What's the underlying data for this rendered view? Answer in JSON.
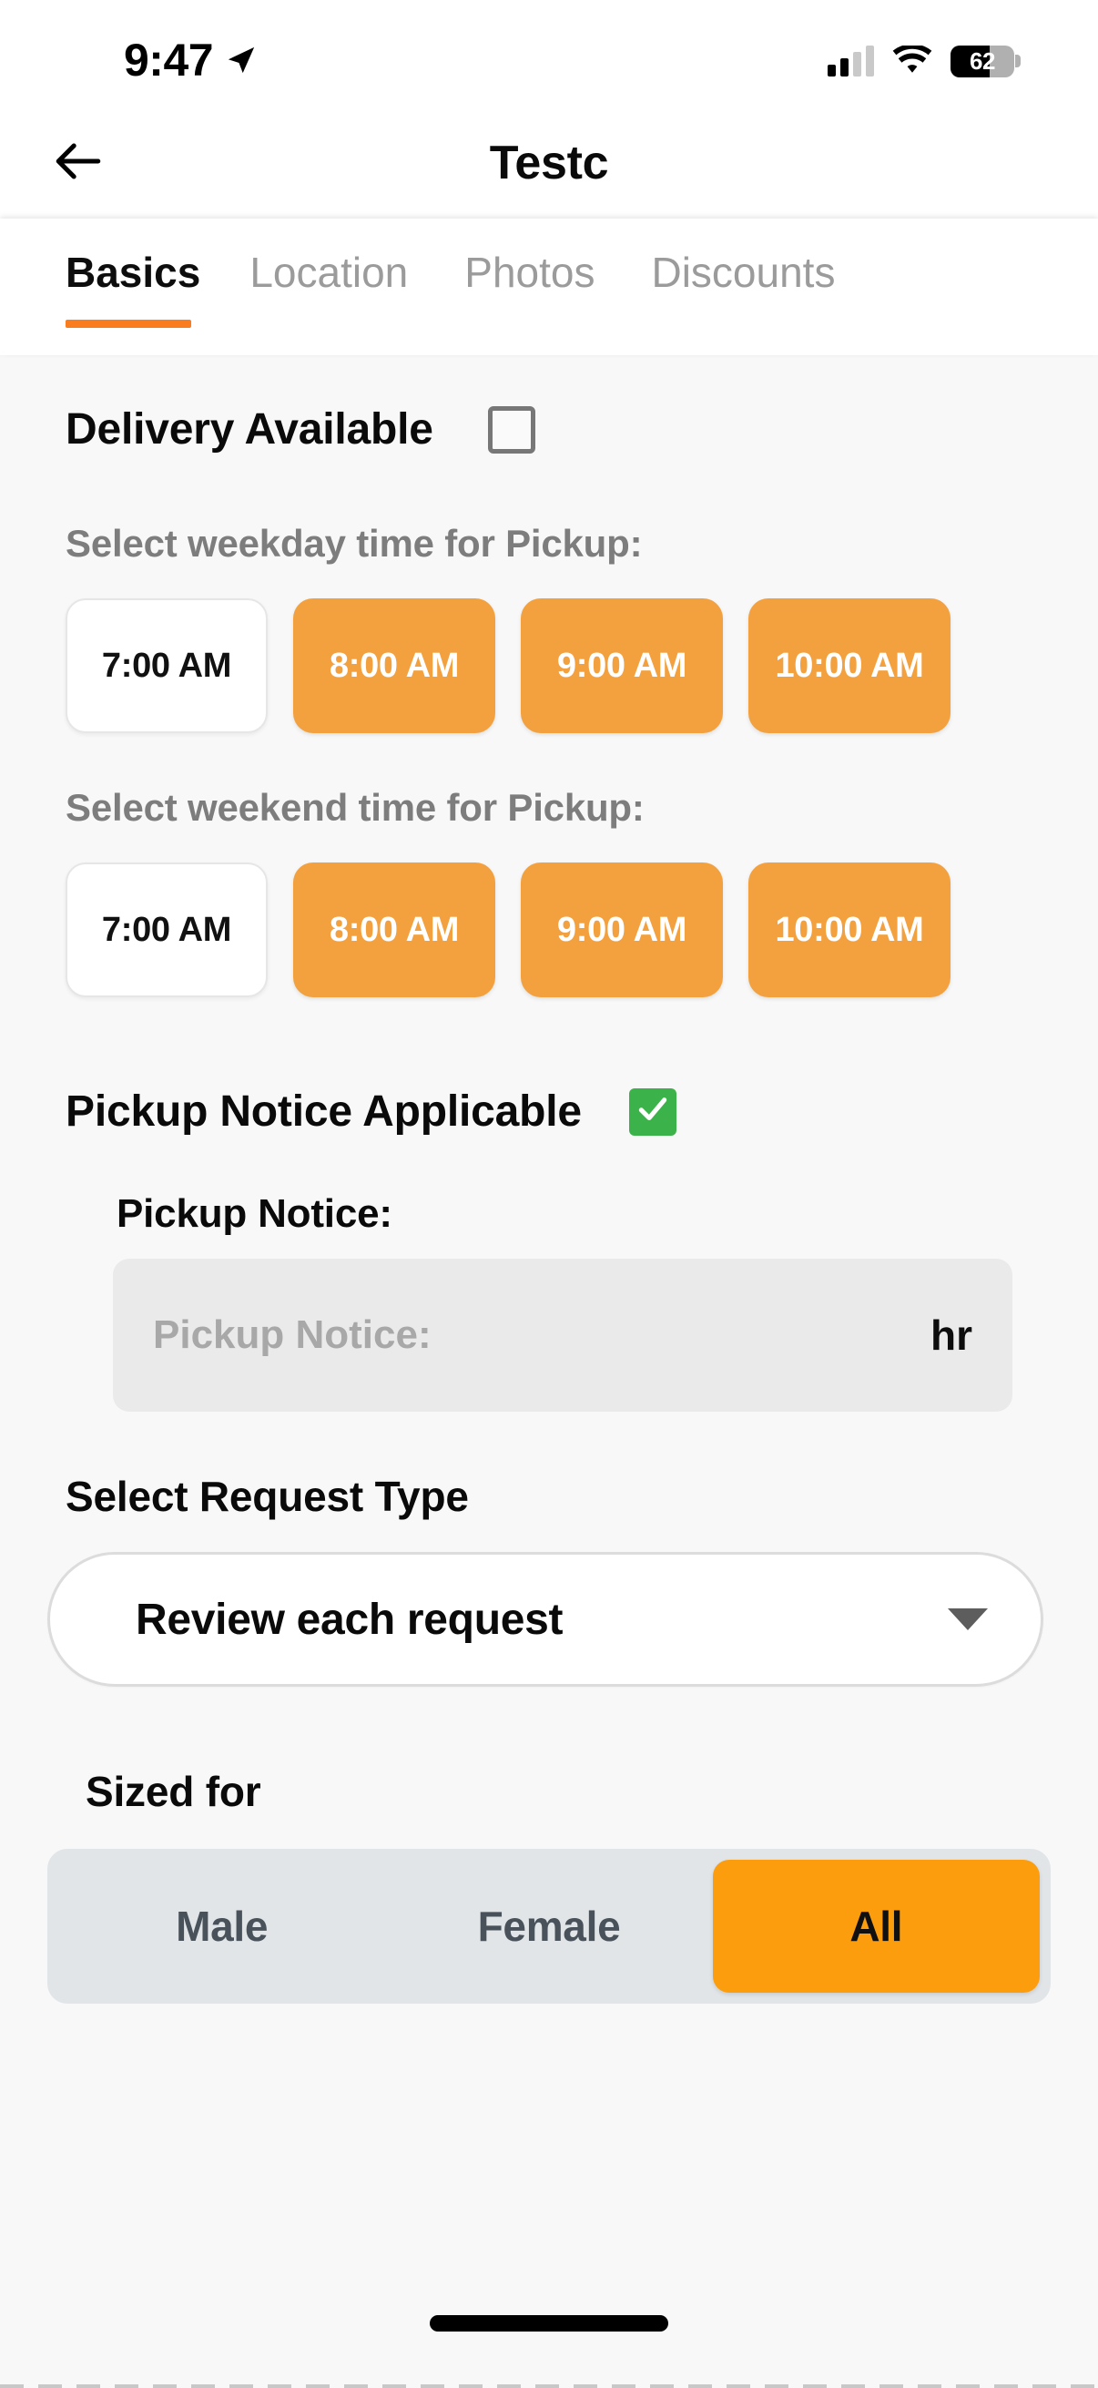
{
  "status_bar": {
    "time": "9:47",
    "location_icon": "location-arrow-icon",
    "signal_icon": "cellular-signal-icon",
    "signal_bars_filled": 2,
    "signal_bars_total": 4,
    "wifi_icon": "wifi-icon",
    "battery_percent": "62",
    "battery_level": 62
  },
  "navbar": {
    "back_icon": "back-arrow-icon",
    "title": "Testc"
  },
  "tabs": {
    "items": [
      {
        "label": "Basics",
        "active": true
      },
      {
        "label": "Location",
        "active": false
      },
      {
        "label": "Photos",
        "active": false
      },
      {
        "label": "Discounts",
        "active": false
      }
    ],
    "active_indicator_color": "#f97c1f"
  },
  "delivery": {
    "label": "Delivery Available",
    "checked": false,
    "checkbox_icon": "checkbox-unchecked-icon"
  },
  "weekday_pickup": {
    "label": "Select weekday time for Pickup:",
    "options": [
      {
        "label": "7:00 AM",
        "selected": false
      },
      {
        "label": "8:00 AM",
        "selected": true
      },
      {
        "label": "9:00 AM",
        "selected": true
      },
      {
        "label": "10:00 AM",
        "selected": true
      }
    ]
  },
  "weekend_pickup": {
    "label": "Select weekend time for Pickup:",
    "options": [
      {
        "label": "7:00 AM",
        "selected": false
      },
      {
        "label": "8:00 AM",
        "selected": true
      },
      {
        "label": "9:00 AM",
        "selected": true
      },
      {
        "label": "10:00 AM",
        "selected": true
      }
    ]
  },
  "pickup_notice": {
    "toggle_label": "Pickup Notice Applicable",
    "checked": true,
    "checkbox_icon": "checkbox-checked-icon",
    "field_label": "Pickup Notice:",
    "input_value": "",
    "input_placeholder": "Pickup Notice:",
    "unit_suffix": "hr"
  },
  "request_type": {
    "label": "Select Request Type",
    "selected": "Review each request",
    "caret_icon": "chevron-down-icon"
  },
  "sized_for": {
    "label": "Sized for",
    "options": [
      {
        "label": "Male",
        "selected": false
      },
      {
        "label": "Female",
        "selected": false
      },
      {
        "label": "All",
        "selected": true
      }
    ]
  },
  "colors": {
    "accent_orange": "#f97c1f",
    "chip_orange": "#f3a13f",
    "segment_orange": "#fb9d0c",
    "check_green": "#3cb34a",
    "page_background": "#f8f8f8"
  },
  "home_indicator": "home-indicator-bar"
}
